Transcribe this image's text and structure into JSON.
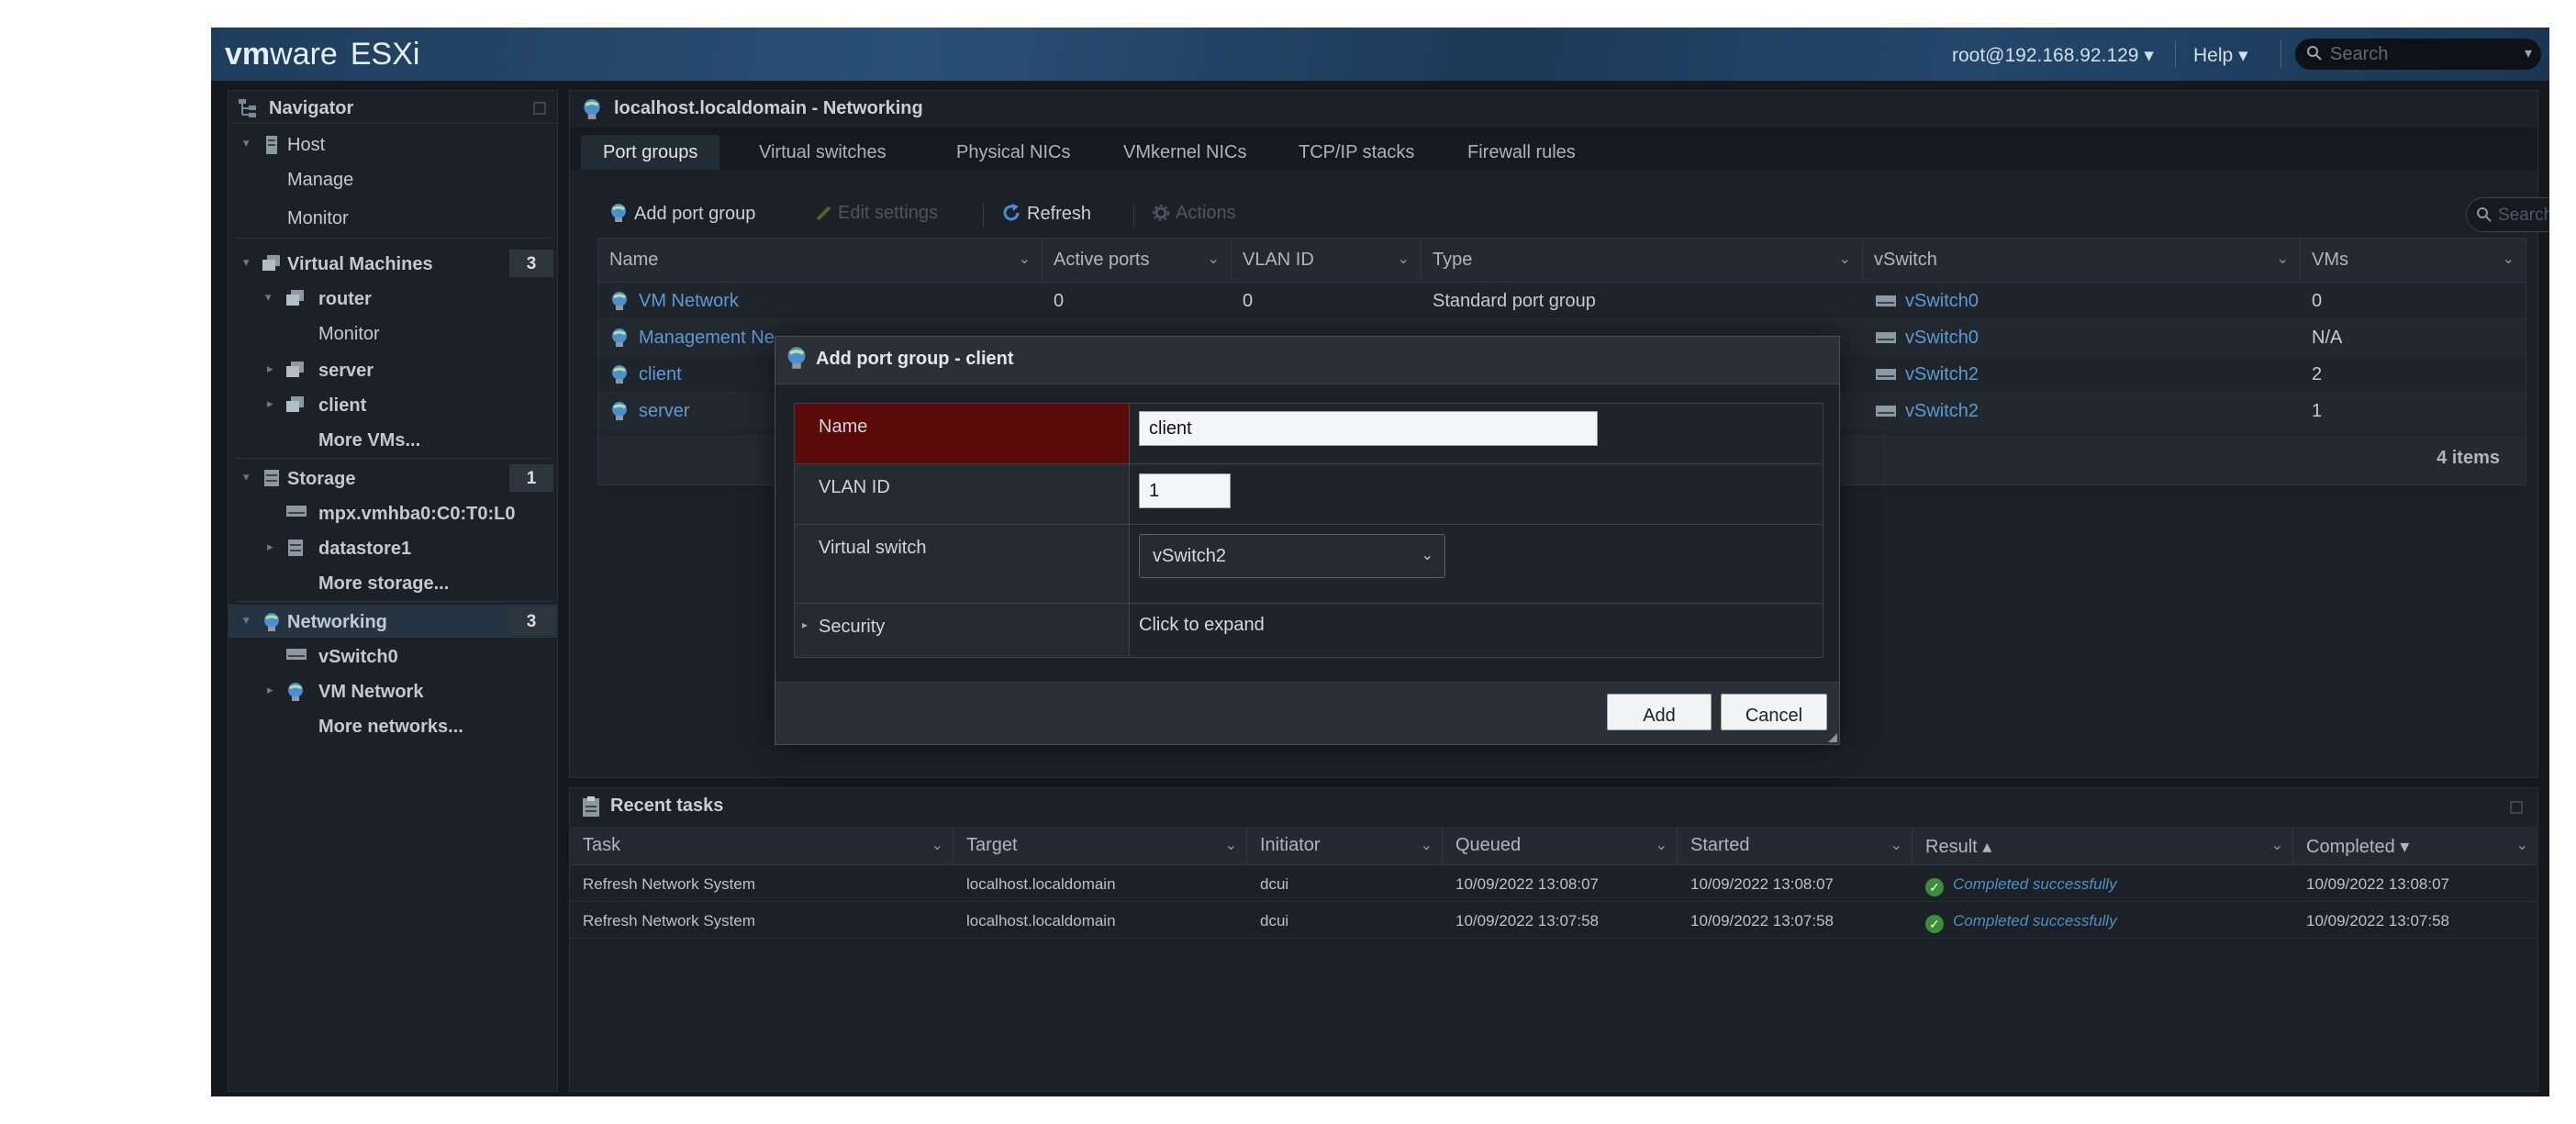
{
  "header": {
    "logo_vm": "vm",
    "logo_ware": "ware",
    "logo_product": "ESXi",
    "user": "root@192.168.92.129 ▾",
    "help": "Help ▾",
    "search_placeholder": "Search"
  },
  "navigator": {
    "title": "Navigator",
    "items": [
      {
        "label": "Host"
      },
      {
        "label": "Manage"
      },
      {
        "label": "Monitor"
      },
      {
        "label": "Virtual Machines",
        "count": "3"
      },
      {
        "label": "router"
      },
      {
        "label": "Monitor"
      },
      {
        "label": "server"
      },
      {
        "label": "client"
      },
      {
        "label": "More VMs..."
      },
      {
        "label": "Storage",
        "count": "1"
      },
      {
        "label": "mpx.vmhba0:C0:T0:L0"
      },
      {
        "label": "datastore1"
      },
      {
        "label": "More storage..."
      },
      {
        "label": "Networking",
        "count": "3"
      },
      {
        "label": "vSwitch0"
      },
      {
        "label": "VM Network"
      },
      {
        "label": "More networks..."
      }
    ]
  },
  "main": {
    "title": "localhost.localdomain - Networking",
    "tabs": [
      {
        "label": "Port groups"
      },
      {
        "label": "Virtual switches"
      },
      {
        "label": "Physical NICs"
      },
      {
        "label": "VMkernel NICs"
      },
      {
        "label": "TCP/IP stacks"
      },
      {
        "label": "Firewall rules"
      }
    ],
    "toolbar": {
      "add": "Add port group",
      "edit": "Edit settings",
      "refresh": "Refresh",
      "actions": "Actions",
      "search_placeholder": "Search"
    },
    "columns": [
      "Name",
      "Active ports",
      "VLAN ID",
      "Type",
      "vSwitch",
      "VMs"
    ],
    "rows": [
      {
        "name": "VM Network",
        "active": "0",
        "vlan": "0",
        "type": "Standard port group",
        "vswitch": "vSwitch0",
        "vms": "0"
      },
      {
        "name": "Management Ne",
        "active": "",
        "vlan": "",
        "type": "",
        "vswitch": "vSwitch0",
        "vms": "N/A"
      },
      {
        "name": "client",
        "active": "",
        "vlan": "",
        "type": "",
        "vswitch": "vSwitch2",
        "vms": "2"
      },
      {
        "name": "server",
        "active": "",
        "vlan": "",
        "type": "",
        "vswitch": "vSwitch2",
        "vms": "1"
      }
    ],
    "item_count": "4 items"
  },
  "tasks": {
    "title": "Recent tasks",
    "columns": [
      "Task",
      "Target",
      "Initiator",
      "Queued",
      "Started",
      "Result ▴",
      "Completed ▾"
    ],
    "rows": [
      {
        "task": "Refresh Network System",
        "target": "localhost.localdomain",
        "initiator": "dcui",
        "queued": "10/09/2022 13:08:07",
        "started": "10/09/2022 13:08:07",
        "result": "Completed successfully",
        "completed": "10/09/2022 13:08:07"
      },
      {
        "task": "Refresh Network System",
        "target": "localhost.localdomain",
        "initiator": "dcui",
        "queued": "10/09/2022 13:07:58",
        "started": "10/09/2022 13:07:58",
        "result": "Completed successfully",
        "completed": "10/09/2022 13:07:58"
      }
    ]
  },
  "dialog": {
    "title": "Add port group - client",
    "name_label": "Name",
    "name_value": "client",
    "vlan_label": "VLAN ID",
    "vlan_value": "1",
    "vswitch_label": "Virtual switch",
    "vswitch_value": "vSwitch2",
    "security_label": "Security",
    "security_value": "Click to expand",
    "add_button": "Add",
    "cancel_button": "Cancel"
  },
  "colors": {
    "accent_link": "#5b9bd5",
    "error_label_bg": "#5b0a0a",
    "success": "#3d8d3a"
  }
}
